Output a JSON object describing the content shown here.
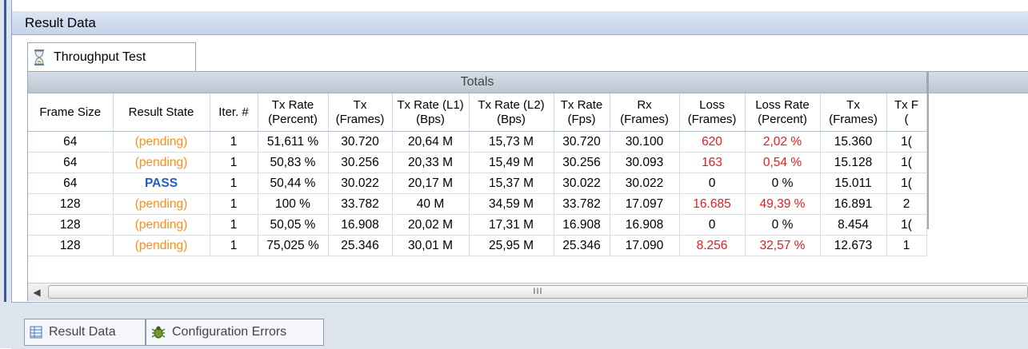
{
  "window": {
    "title": "Result Data"
  },
  "document_tab": {
    "label": "Throughput Test",
    "icon": "hourglass-icon"
  },
  "grid": {
    "group_header": "Totals",
    "columns": [
      [
        "Frame Size",
        ""
      ],
      [
        "Result State",
        ""
      ],
      [
        "Iter. #",
        ""
      ],
      [
        "Tx Rate",
        "(Percent)"
      ],
      [
        "Tx",
        "(Frames)"
      ],
      [
        "Tx Rate (L1)",
        "(Bps)"
      ],
      [
        "Tx Rate (L2)",
        "(Bps)"
      ],
      [
        "Tx Rate",
        "(Fps)"
      ],
      [
        "Rx",
        "(Frames)"
      ],
      [
        "Loss",
        "(Frames)"
      ],
      [
        "Loss Rate",
        "(Percent)"
      ],
      [
        "Tx",
        "(Frames)"
      ],
      [
        "Tx F",
        "("
      ]
    ],
    "rows": [
      {
        "cells": [
          "64",
          "(pending)",
          "1",
          "51,611 %",
          "30.720",
          "20,64 M",
          "15,73 M",
          "30.720",
          "30.100",
          "620",
          "2,02 %",
          "15.360",
          "1("
        ],
        "state": "pending",
        "loss_red": true
      },
      {
        "cells": [
          "64",
          "(pending)",
          "1",
          "50,83 %",
          "30.256",
          "20,33 M",
          "15,49 M",
          "30.256",
          "30.093",
          "163",
          "0,54 %",
          "15.128",
          "1("
        ],
        "state": "pending",
        "loss_red": true
      },
      {
        "cells": [
          "64",
          "PASS",
          "1",
          "50,44 %",
          "30.022",
          "20,17 M",
          "15,37 M",
          "30.022",
          "30.022",
          "0",
          "0 %",
          "15.011",
          "1("
        ],
        "state": "pass",
        "loss_red": false
      },
      {
        "cells": [
          "128",
          "(pending)",
          "1",
          "100 %",
          "33.782",
          "40 M",
          "34,59 M",
          "33.782",
          "17.097",
          "16.685",
          "49,39 %",
          "16.891",
          "2"
        ],
        "state": "pending",
        "loss_red": true
      },
      {
        "cells": [
          "128",
          "(pending)",
          "1",
          "50,05 %",
          "16.908",
          "20,02 M",
          "17,31 M",
          "16.908",
          "16.908",
          "0",
          "0 %",
          "8.454",
          "1("
        ],
        "state": "pending",
        "loss_red": false
      },
      {
        "cells": [
          "128",
          "(pending)",
          "1",
          "75,025 %",
          "25.346",
          "30,01 M",
          "25,95 M",
          "25.346",
          "17.090",
          "8.256",
          "32,57 %",
          "12.673",
          "1"
        ],
        "state": "pending",
        "loss_red": true
      }
    ]
  },
  "scrollbar": {
    "grip": "III"
  },
  "bottom_tabs": [
    {
      "label": "Result Data",
      "icon": "grid-icon"
    },
    {
      "label": "Configuration Errors",
      "icon": "bug-icon"
    }
  ],
  "colors": {
    "pending": "#ff8c1a",
    "pass": "#1f5fbf",
    "loss": "#f01818",
    "title_bar": "#c6d4ea"
  }
}
